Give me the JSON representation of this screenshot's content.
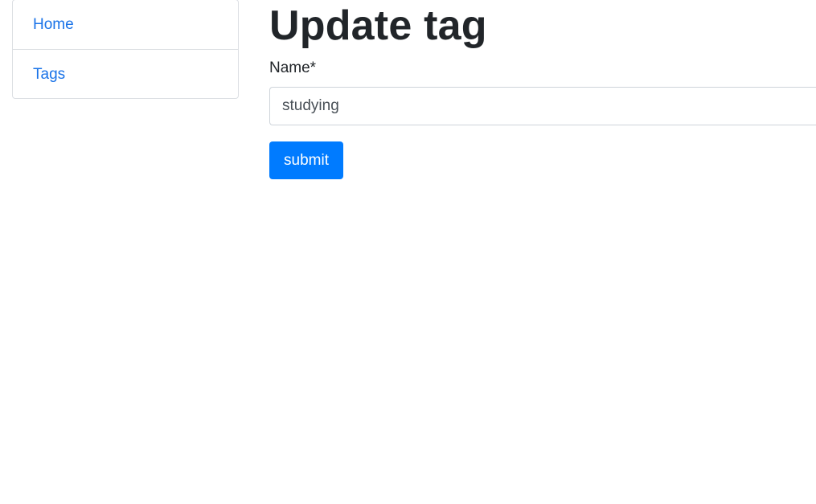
{
  "sidebar": {
    "items": [
      {
        "label": "Home"
      },
      {
        "label": "Tags"
      }
    ]
  },
  "main": {
    "title": "Update tag",
    "form": {
      "name_label": "Name*",
      "name_value": "studying",
      "submit_label": "submit"
    }
  },
  "colors": {
    "link": "#1a73e8",
    "primary_button": "#007bff",
    "text": "#212529"
  }
}
